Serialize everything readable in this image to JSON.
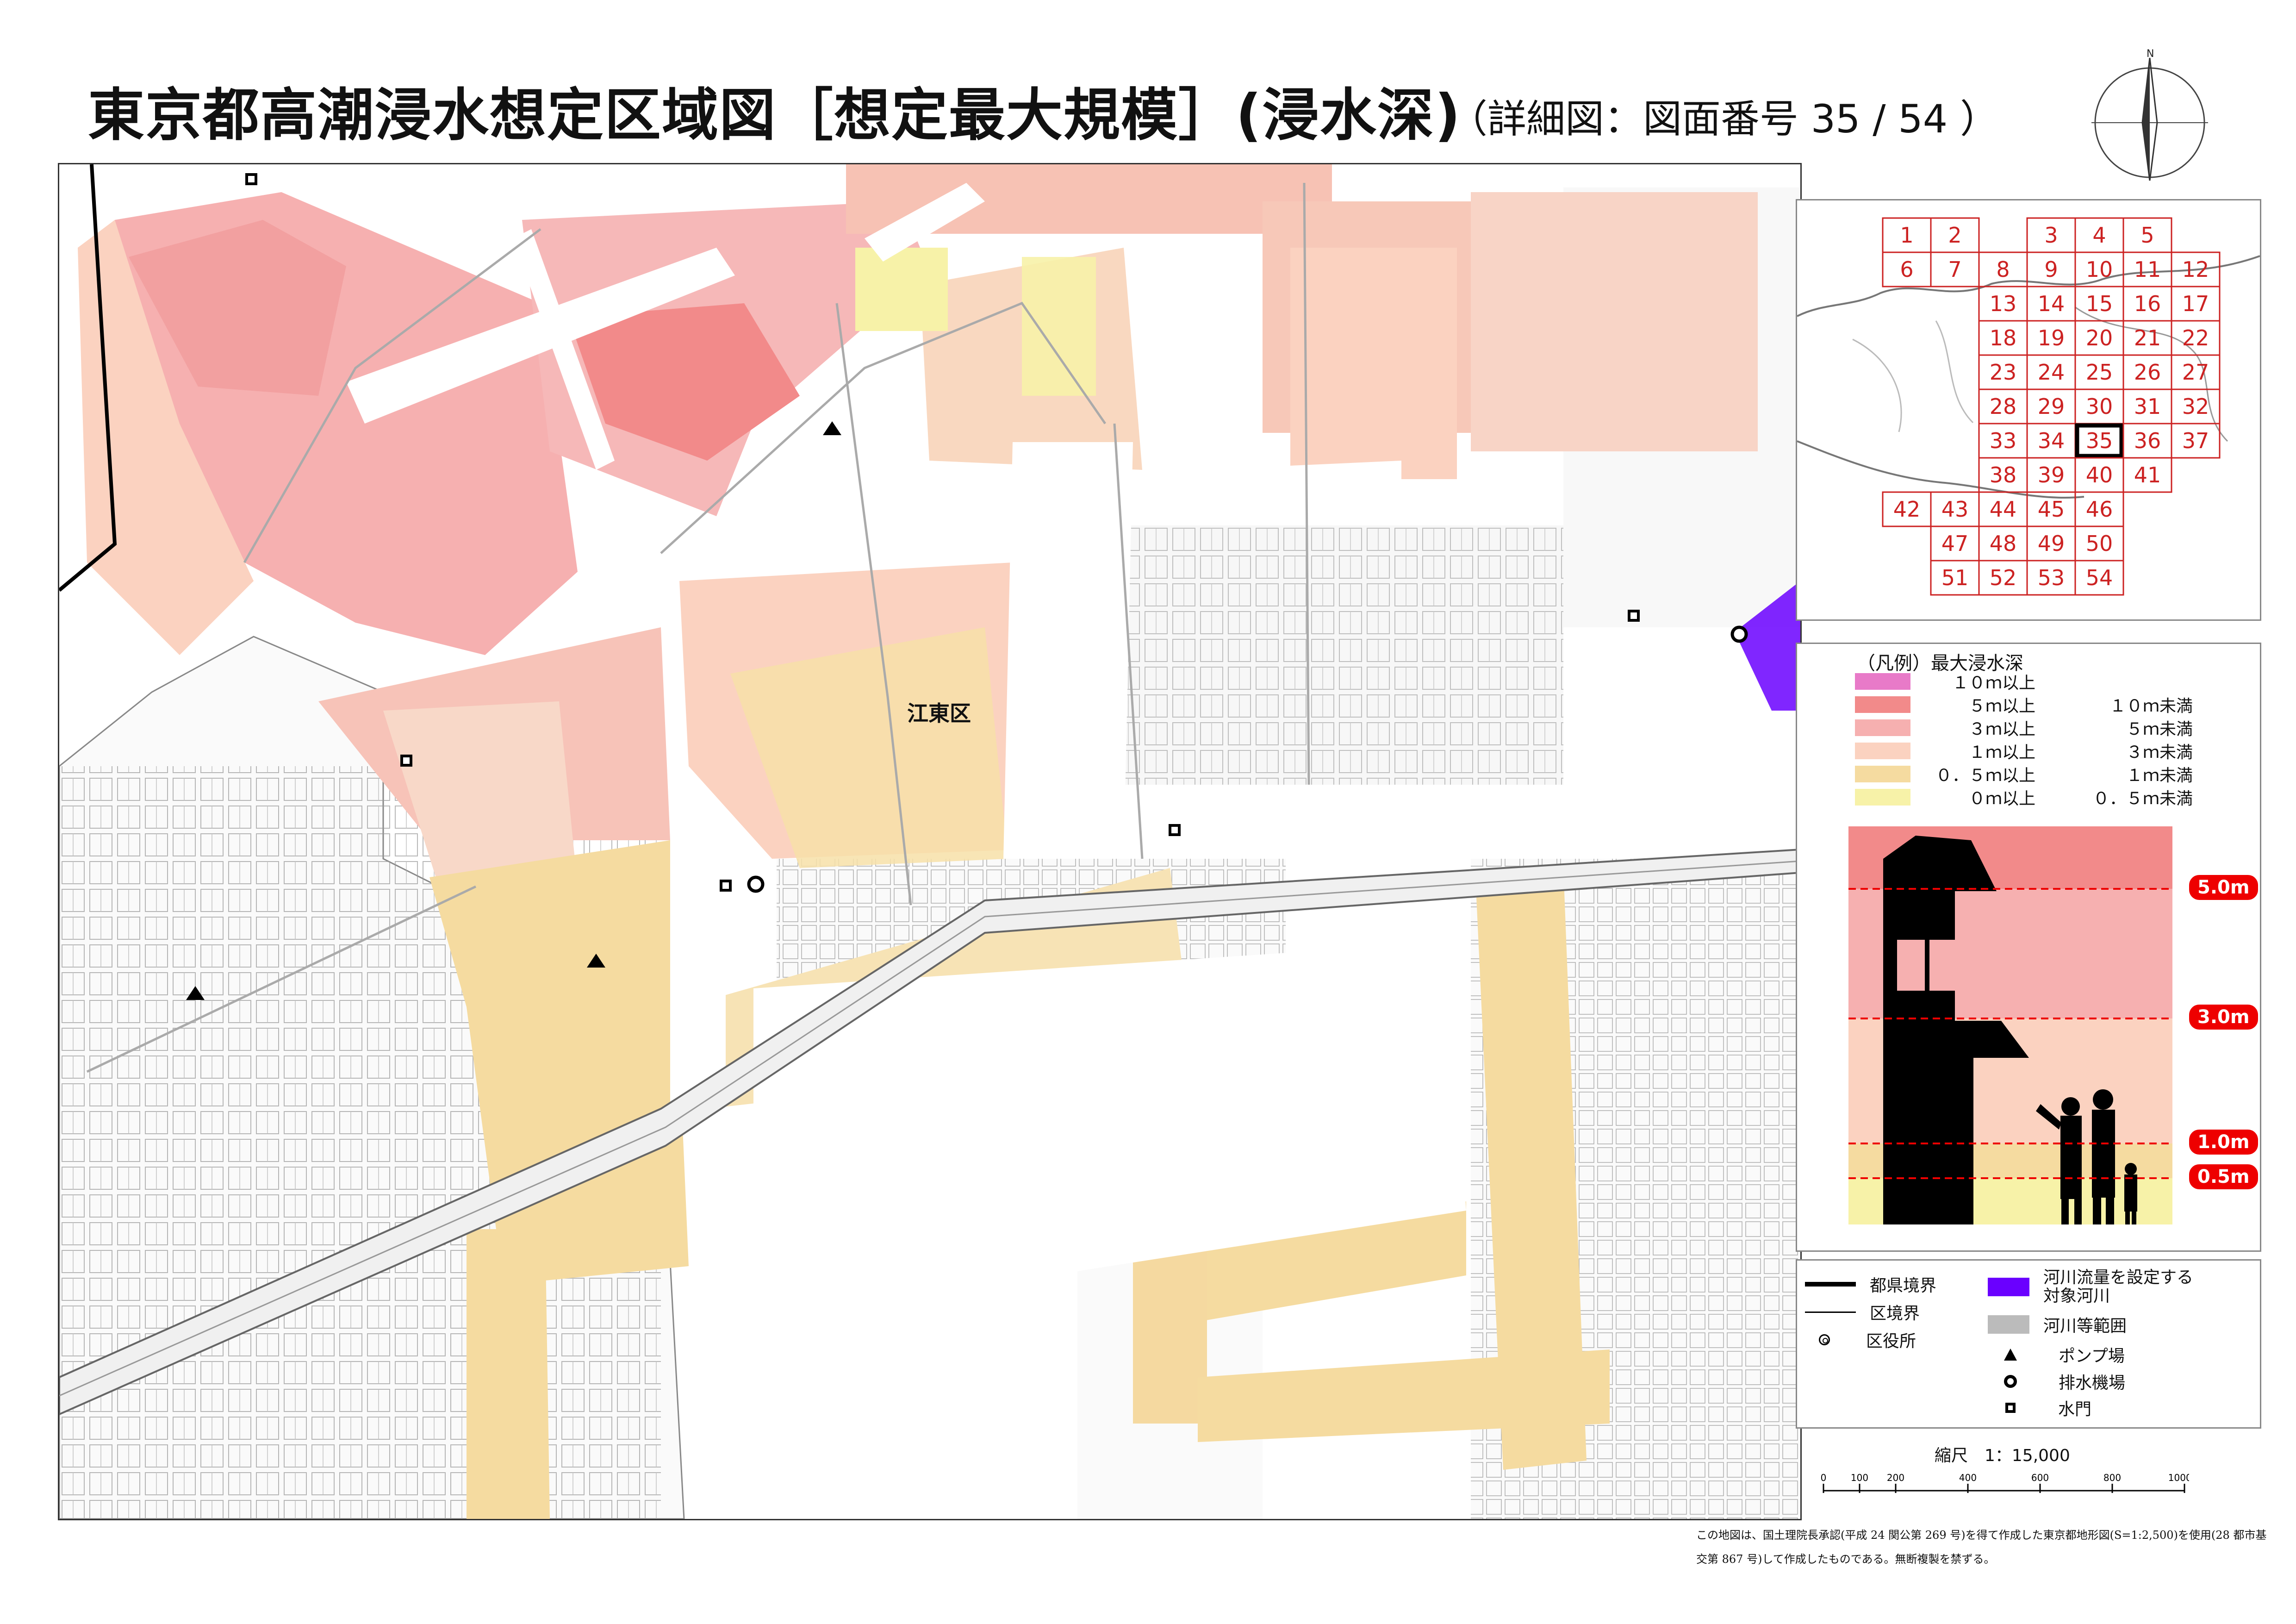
{
  "title": "東京都高潮浸水想定区域図［想定最大規模］(浸水深)",
  "subtitle": "（詳細図：図面番号 35 / 54 ）",
  "compass_label": "N",
  "ward_label": "江東区",
  "index_map": {
    "numbers": [
      "1",
      "2",
      "3",
      "4",
      "5",
      "6",
      "7",
      "8",
      "9",
      "10",
      "11",
      "12",
      "13",
      "14",
      "15",
      "16",
      "17",
      "18",
      "19",
      "20",
      "21",
      "22",
      "23",
      "24",
      "25",
      "26",
      "27",
      "28",
      "29",
      "30",
      "31",
      "32",
      "33",
      "34",
      "35",
      "36",
      "37",
      "38",
      "39",
      "40",
      "41",
      "42",
      "43",
      "44",
      "45",
      "46",
      "47",
      "48",
      "49",
      "50",
      "51",
      "52",
      "53",
      "54"
    ],
    "current": "35",
    "grid_color": "#cc2222",
    "number_color": "#cc2222"
  },
  "legend": {
    "title": "（凡例）最大浸水深",
    "items": [
      {
        "color": "#e87ac8",
        "a": "１０ｍ以上",
        "b": ""
      },
      {
        "color": "#f28a8a",
        "a": "５ｍ以上",
        "b": "１０ｍ未満"
      },
      {
        "color": "#f6b0b0",
        "a": "３ｍ以上",
        "b": "５ｍ未満"
      },
      {
        "color": "#fbd2c0",
        "a": "１ｍ以上",
        "b": "３ｍ未満"
      },
      {
        "color": "#f5dba0",
        "a": "０．５ｍ以上",
        "b": "１ｍ未満"
      },
      {
        "color": "#f7f2a8",
        "a": "０ｍ以上",
        "b": "０．５ｍ未満"
      }
    ],
    "depth_labels": [
      "5.0m",
      "3.0m",
      "1.0m",
      "0.5m"
    ]
  },
  "symbols": {
    "prefecture_boundary": "都県境界",
    "ward_boundary": "区境界",
    "ward_office": "区役所",
    "river_target_1": "河川流量を設定する",
    "river_target_2": "対象河川",
    "river_area": "河川等範囲",
    "pump": "ポンプ場",
    "drainage": "排水機場",
    "floodgate": "水門"
  },
  "scale": {
    "text": "縮尺　1：15,000",
    "ticks": [
      "0",
      "100",
      "200",
      "400",
      "600",
      "800",
      "1000m"
    ]
  },
  "footnote": "この地図は、国土理院長承認(平成 24 関公第 269 号)を得て作成した東京都地形図(S=1:2,500)を使用(28 都市基交第 867 号)して作成したものである。無断複製を禁ずる。",
  "colors": {
    "depth_5_10": "#f28a8a",
    "depth_3_5": "#f6b0b0",
    "depth_1_3": "#fbd2c0",
    "depth_05_1": "#f5dba0",
    "depth_0_05": "#f7f2a8",
    "river_target": "#6a00ff",
    "river_area": "#bbbbbb"
  }
}
